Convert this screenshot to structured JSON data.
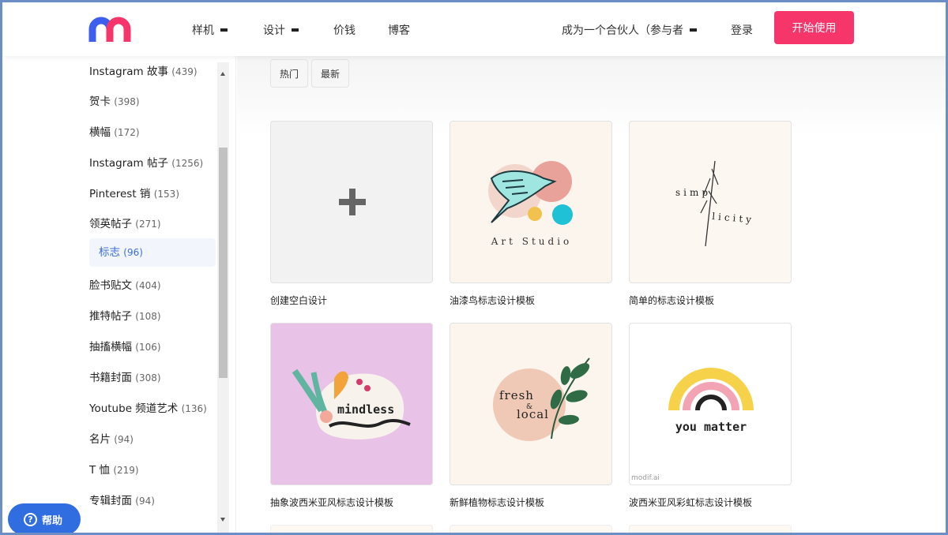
{
  "header": {
    "nav": [
      {
        "label": "样机",
        "dropdown": true
      },
      {
        "label": "设计",
        "dropdown": true
      },
      {
        "label": "价钱",
        "dropdown": false
      },
      {
        "label": "博客",
        "dropdown": false
      }
    ],
    "partner_label": "成为一个合伙人（参与者",
    "login_label": "登录",
    "start_label": "开始使用",
    "colors": {
      "accent": "#f6366a",
      "logo_blue": "#3c5ff0",
      "logo_pink": "#f6366a"
    }
  },
  "sidebar": {
    "categories": [
      {
        "name": "Instagram 故事",
        "count": "(439)"
      },
      {
        "name": "贺卡",
        "count": "(398)"
      },
      {
        "name": "横幅",
        "count": "(172)"
      },
      {
        "name": "Instagram 帖子",
        "count": "(1256)"
      },
      {
        "name": "Pinterest 销",
        "count": "(153)"
      },
      {
        "name": "领英帖子",
        "count": "(271)"
      },
      {
        "name": "标志",
        "count": "(96)",
        "active": true
      },
      {
        "name": "脸书贴文",
        "count": "(404)"
      },
      {
        "name": "推特帖子",
        "count": "(108)"
      },
      {
        "name": "抽搐横幅",
        "count": "(106)"
      },
      {
        "name": "书籍封面",
        "count": "(308)"
      },
      {
        "name": "Youtube 频道艺术",
        "count": "(136)"
      },
      {
        "name": "名片",
        "count": "(94)"
      },
      {
        "name": "T 恤",
        "count": "(219)"
      },
      {
        "name": "专辑封面",
        "count": "(94)"
      }
    ]
  },
  "help": {
    "label": "帮助"
  },
  "filters": [
    {
      "label": "热门"
    },
    {
      "label": "最新"
    }
  ],
  "cards": [
    {
      "label": "创建空白设计",
      "icon": "plus-icon"
    },
    {
      "label": "油漆鸟标志设计模板",
      "text": "Art Studio"
    },
    {
      "label": "简单的标志设计模板",
      "text_a": "simp",
      "text_b": "licity"
    },
    {
      "label": "抽象波西米亚风标志设计模板",
      "text": "mindless"
    },
    {
      "label": "新鲜植物标志设计模板",
      "text_a": "fresh",
      "text_amp": "&",
      "text_b": "local"
    },
    {
      "label": "波西米亚风彩虹标志设计模板",
      "text": "you matter",
      "watermark": "modif.ai"
    }
  ]
}
